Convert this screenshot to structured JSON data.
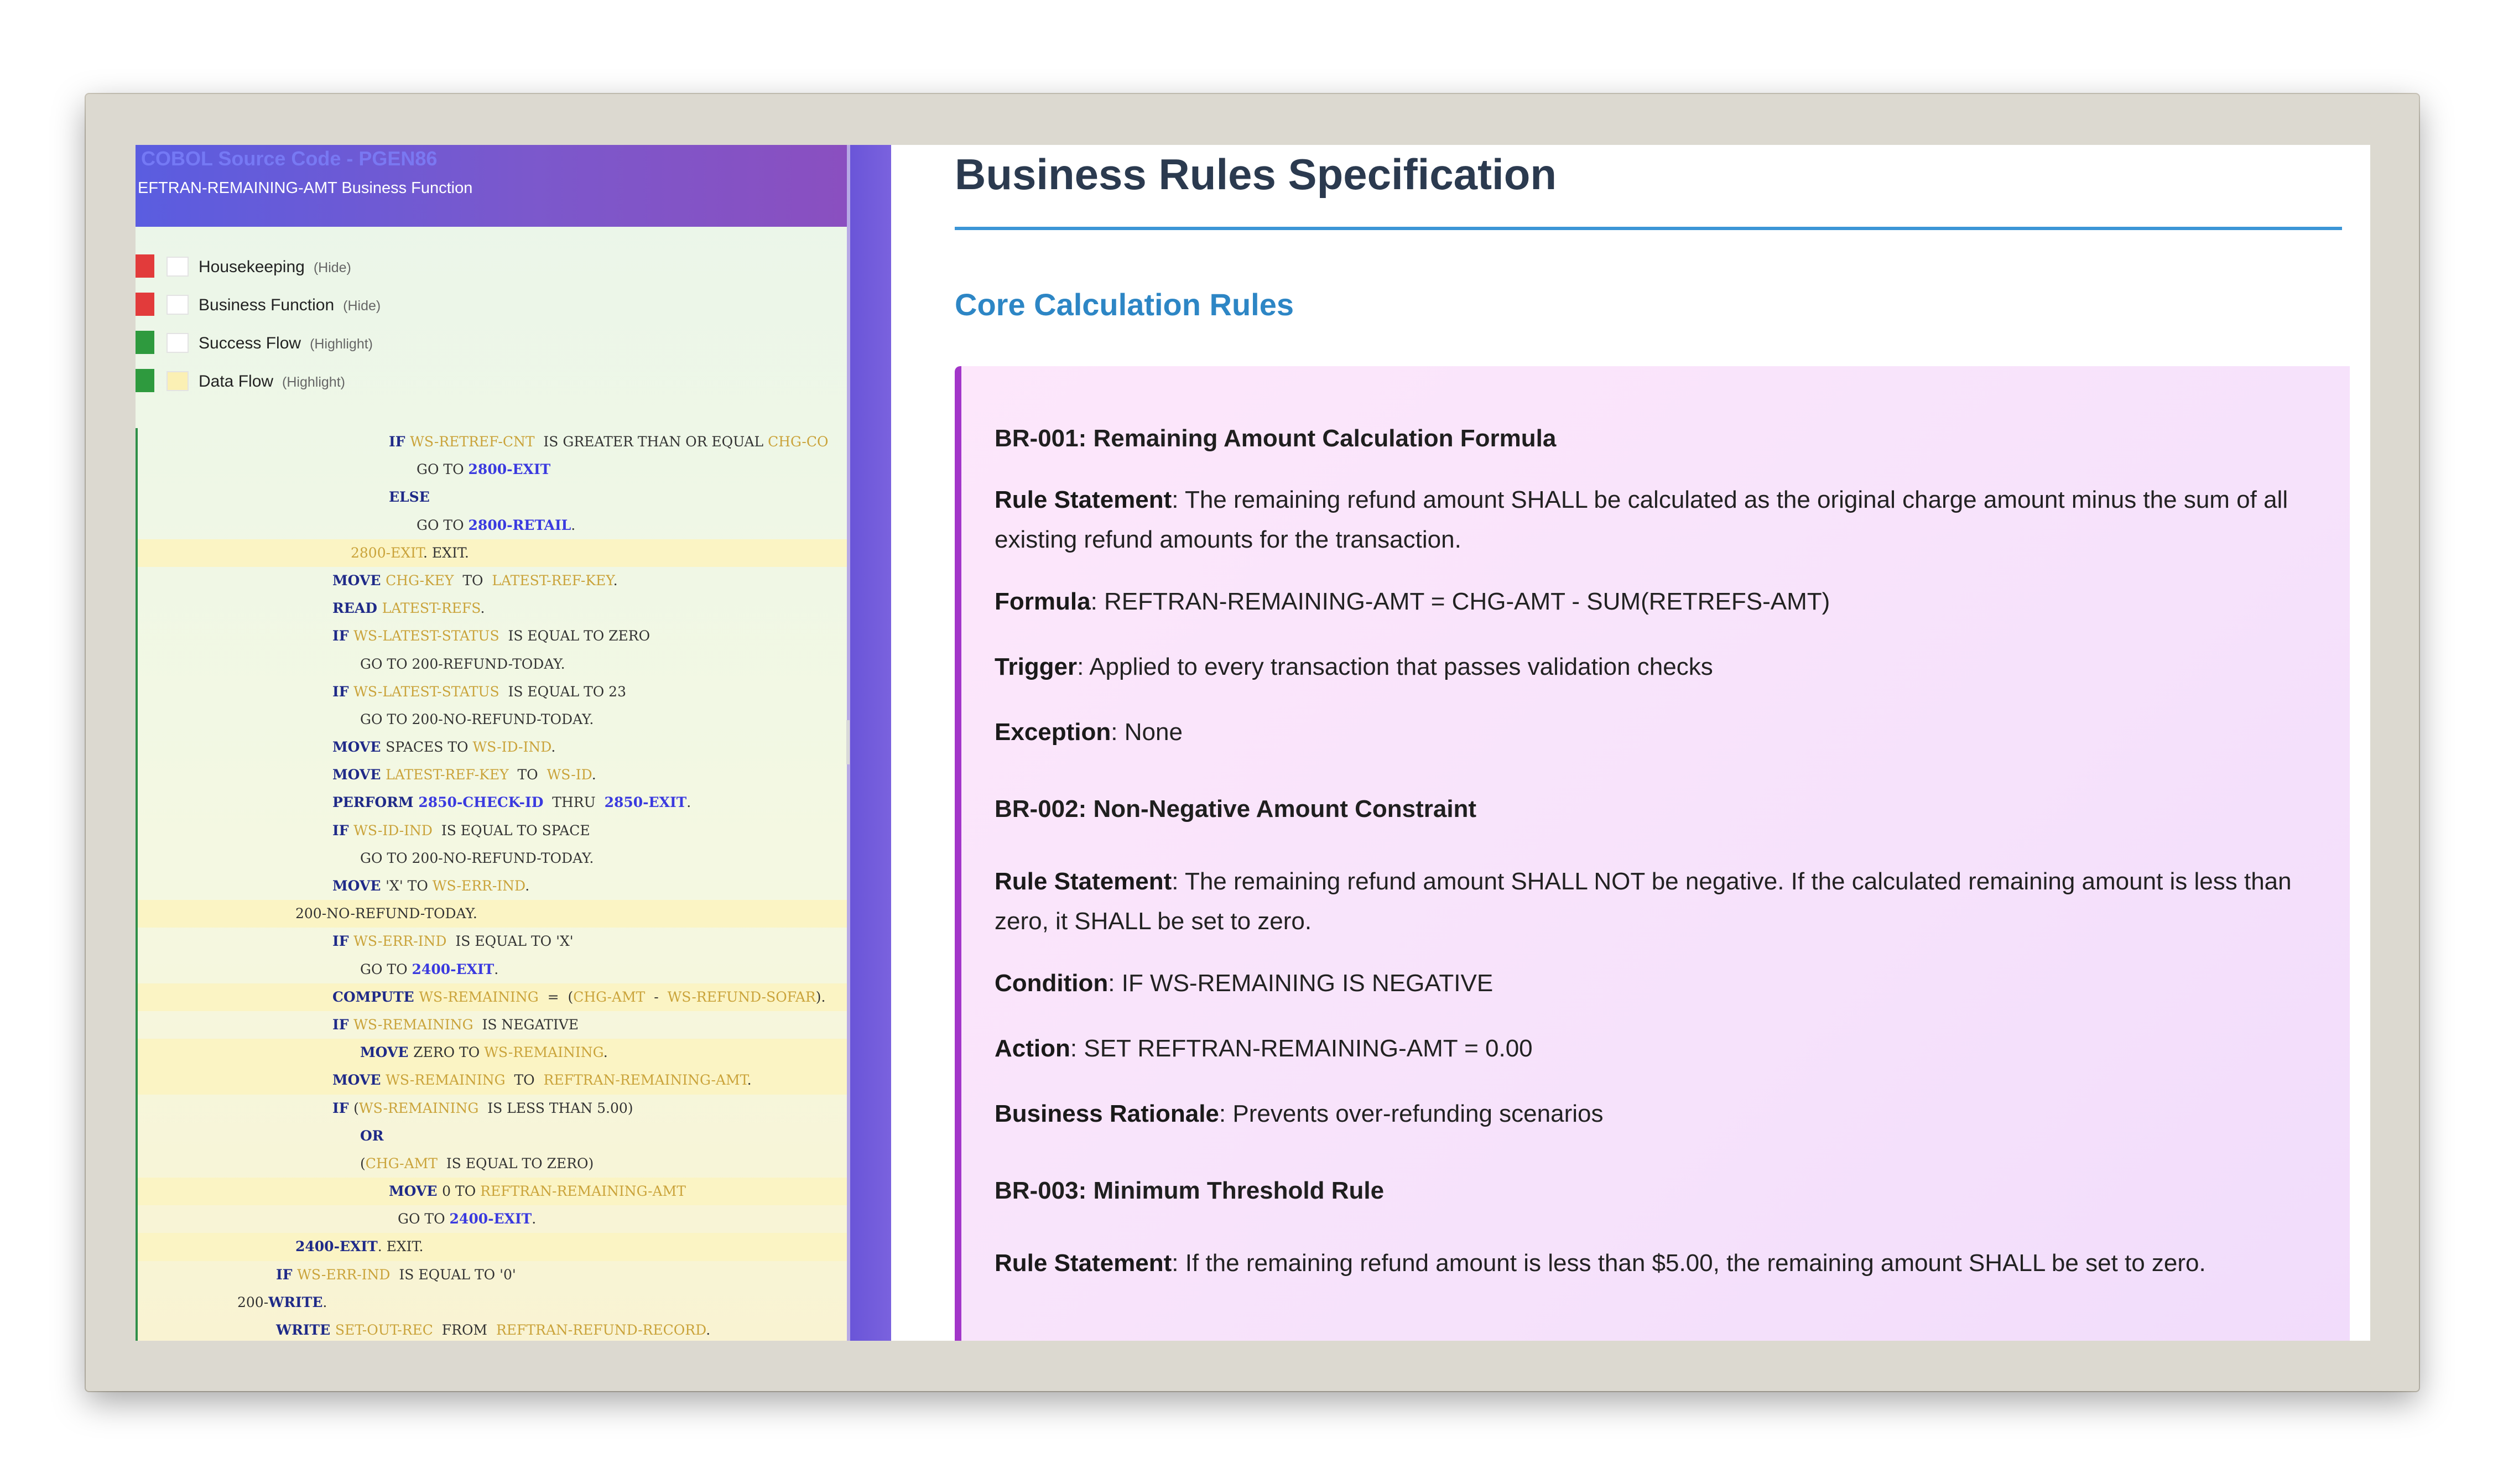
{
  "left_panel": {
    "title": "COBOL Source Code - PGEN86",
    "subtitle": "EFTRAN-REMAINING-AMT Business Function",
    "legend": [
      {
        "label": "Housekeeping",
        "action": "(Hide)",
        "color": "#e23b3b",
        "box": "#ffffff"
      },
      {
        "label": "Business Function",
        "action": "(Hide)",
        "color": "#e23b3b",
        "box": "#ffffff"
      },
      {
        "label": "Success Flow",
        "action": "(Highlight)",
        "color": "#2e9a3e",
        "box": "#ffffff"
      },
      {
        "label": "Data Flow",
        "action": "(Highlight)",
        "color": "#2e9a3e",
        "box": "#fbf0b4"
      }
    ],
    "code_lines": [
      {
        "indent": 454,
        "hl": false,
        "tokens": [
          [
            "kw",
            "IF "
          ],
          [
            "var",
            "WS-RETREF-CNT"
          ],
          [
            "",
            "  IS GREATER THAN OR EQUAL "
          ],
          [
            "var",
            "CHG-CO"
          ]
        ]
      },
      {
        "indent": 504,
        "hl": false,
        "tokens": [
          [
            "",
            "GO TO "
          ],
          [
            "lbl",
            "2800-EXIT"
          ]
        ]
      },
      {
        "indent": 454,
        "hl": false,
        "tokens": [
          [
            "kw",
            "ELSE"
          ]
        ]
      },
      {
        "indent": 504,
        "hl": false,
        "tokens": [
          [
            "",
            "GO TO "
          ],
          [
            "lbl",
            "2800-RETAIL"
          ],
          [
            "",
            "."
          ]
        ]
      },
      {
        "indent": 385,
        "hl": true,
        "tokens": [
          [
            "var",
            "2800-EXIT"
          ],
          [
            "",
            ". EXIT."
          ]
        ]
      },
      {
        "indent": 352,
        "hl": false,
        "tokens": [
          [
            "kw",
            "MOVE "
          ],
          [
            "var",
            "CHG-KEY"
          ],
          [
            "",
            "  TO  "
          ],
          [
            "var",
            "LATEST-REF-KEY"
          ],
          [
            "",
            "."
          ]
        ]
      },
      {
        "indent": 352,
        "hl": false,
        "tokens": [
          [
            "kw",
            "READ "
          ],
          [
            "var",
            "LATEST-REFS"
          ],
          [
            "",
            "."
          ]
        ]
      },
      {
        "indent": 352,
        "hl": false,
        "tokens": [
          [
            "kw",
            "IF "
          ],
          [
            "var",
            "WS-LATEST-STATUS"
          ],
          [
            "",
            "  IS EQUAL TO ZERO"
          ]
        ]
      },
      {
        "indent": 402,
        "hl": false,
        "tokens": [
          [
            "",
            "GO TO 200-REFUND-TODAY."
          ]
        ]
      },
      {
        "indent": 352,
        "hl": false,
        "tokens": [
          [
            "kw",
            "IF "
          ],
          [
            "var",
            "WS-LATEST-STATUS"
          ],
          [
            "",
            "  IS EQUAL TO 23"
          ]
        ]
      },
      {
        "indent": 402,
        "hl": false,
        "tokens": [
          [
            "",
            "GO TO 200-NO-REFUND-TODAY."
          ]
        ]
      },
      {
        "indent": 352,
        "hl": false,
        "tokens": [
          [
            "kw",
            "MOVE "
          ],
          [
            "",
            "SPACES TO "
          ],
          [
            "var",
            "WS-ID-IND"
          ],
          [
            "",
            "."
          ]
        ]
      },
      {
        "indent": 352,
        "hl": false,
        "tokens": [
          [
            "kw",
            "MOVE "
          ],
          [
            "var",
            "LATEST-REF-KEY"
          ],
          [
            "",
            "  TO  "
          ],
          [
            "var",
            "WS-ID"
          ],
          [
            "",
            "."
          ]
        ]
      },
      {
        "indent": 352,
        "hl": false,
        "tokens": [
          [
            "kw",
            "PERFORM "
          ],
          [
            "lbl",
            "2850-CHECK-ID"
          ],
          [
            "",
            "  THRU  "
          ],
          [
            "lbl",
            "2850-EXIT"
          ],
          [
            "",
            "."
          ]
        ]
      },
      {
        "indent": 352,
        "hl": false,
        "tokens": [
          [
            "kw",
            "IF "
          ],
          [
            "var",
            "WS-ID-IND"
          ],
          [
            "",
            "  IS EQUAL TO SPACE"
          ]
        ]
      },
      {
        "indent": 402,
        "hl": false,
        "tokens": [
          [
            "",
            "GO TO 200-NO-REFUND-TODAY."
          ]
        ]
      },
      {
        "indent": 352,
        "hl": false,
        "tokens": [
          [
            "kw",
            "MOVE "
          ],
          [
            "",
            "'X' TO "
          ],
          [
            "var",
            "WS-ERR-IND"
          ],
          [
            "",
            "."
          ]
        ]
      },
      {
        "indent": 285,
        "hl": true,
        "tokens": [
          [
            "",
            "200-NO-REFUND-TODAY."
          ]
        ]
      },
      {
        "indent": 352,
        "hl": false,
        "tokens": [
          [
            "kw",
            "IF "
          ],
          [
            "var",
            "WS-ERR-IND"
          ],
          [
            "",
            "  IS EQUAL TO 'X'"
          ]
        ]
      },
      {
        "indent": 402,
        "hl": false,
        "tokens": [
          [
            "",
            "GO TO "
          ],
          [
            "lbl",
            "2400-EXIT"
          ],
          [
            "",
            "."
          ]
        ]
      },
      {
        "indent": 352,
        "hl": true,
        "tokens": [
          [
            "kw",
            "COMPUTE "
          ],
          [
            "var",
            "WS-REMAINING"
          ],
          [
            "",
            "  =  ("
          ],
          [
            "var",
            "CHG-AMT"
          ],
          [
            "",
            "  -  "
          ],
          [
            "var",
            "WS-REFUND-SOFAR"
          ],
          [
            "",
            ")."
          ]
        ]
      },
      {
        "indent": 352,
        "hl": false,
        "tokens": [
          [
            "kw",
            "IF "
          ],
          [
            "var",
            "WS-REMAINING"
          ],
          [
            "",
            "  IS NEGATIVE"
          ]
        ]
      },
      {
        "indent": 402,
        "hl": true,
        "tokens": [
          [
            "kw",
            "MOVE "
          ],
          [
            "",
            "ZERO TO "
          ],
          [
            "var",
            "WS-REMAINING"
          ],
          [
            "",
            "."
          ]
        ]
      },
      {
        "indent": 352,
        "hl": true,
        "tokens": [
          [
            "kw",
            "MOVE "
          ],
          [
            "var",
            "WS-REMAINING"
          ],
          [
            "",
            "  TO  "
          ],
          [
            "var",
            "REFTRAN-REMAINING-AMT"
          ],
          [
            "",
            "."
          ]
        ]
      },
      {
        "indent": 352,
        "hl": false,
        "tokens": [
          [
            "kw",
            "IF "
          ],
          [
            "",
            "("
          ],
          [
            "var",
            "WS-REMAINING"
          ],
          [
            "",
            "  IS LESS THAN 5.00)"
          ]
        ]
      },
      {
        "indent": 402,
        "hl": false,
        "tokens": [
          [
            "kw",
            "OR"
          ]
        ]
      },
      {
        "indent": 402,
        "hl": false,
        "tokens": [
          [
            "",
            "("
          ],
          [
            "var",
            "CHG-AMT"
          ],
          [
            "",
            "  IS EQUAL TO ZERO)"
          ]
        ]
      },
      {
        "indent": 454,
        "hl": true,
        "tokens": [
          [
            "kw",
            "MOVE "
          ],
          [
            "",
            "0 TO "
          ],
          [
            "var",
            "REFTRAN-REMAINING-AMT"
          ]
        ]
      },
      {
        "indent": 470,
        "hl": false,
        "tokens": [
          [
            "",
            "GO TO "
          ],
          [
            "lbl",
            "2400-EXIT"
          ],
          [
            "",
            "."
          ]
        ]
      },
      {
        "indent": 285,
        "hl": true,
        "tokens": [
          [
            "kw",
            "2400-EXIT"
          ],
          [
            "",
            ". EXIT."
          ]
        ]
      },
      {
        "indent": 250,
        "hl": false,
        "tokens": [
          [
            "kw",
            "IF "
          ],
          [
            "var",
            "WS-ERR-IND"
          ],
          [
            "",
            "  IS EQUAL TO '0'"
          ]
        ]
      },
      {
        "indent": 180,
        "hl": false,
        "tokens": [
          [
            "",
            "200-"
          ],
          [
            "kw",
            "WRITE"
          ],
          [
            "",
            "."
          ]
        ]
      },
      {
        "indent": 250,
        "hl": false,
        "tokens": [
          [
            "kw",
            "WRITE "
          ],
          [
            "var",
            "SET-OUT-REC"
          ],
          [
            "",
            "  FROM  "
          ],
          [
            "var",
            "REFTRAN-REFUND-RECORD"
          ],
          [
            "",
            "."
          ]
        ]
      }
    ]
  },
  "right_panel": {
    "title": "Business Rules Specification",
    "section_title": "Core Calculation Rules",
    "rules": [
      {
        "heading": "BR-001: Remaining Amount Calculation Formula",
        "items": [
          {
            "label": "Rule Statement",
            "text": "The remaining refund amount SHALL be calculated as the original charge amount minus the sum of all existing refund amounts for the transaction."
          },
          {
            "label": "Formula",
            "text": "REFTRAN-REMAINING-AMT = CHG-AMT - SUM(RETREFS-AMT)"
          },
          {
            "label": "Trigger",
            "text": "Applied to every transaction that passes validation checks"
          },
          {
            "label": "Exception",
            "text": "None"
          }
        ]
      },
      {
        "heading": "BR-002: Non-Negative Amount Constraint",
        "items": [
          {
            "label": "Rule Statement",
            "text": "The remaining refund amount SHALL NOT be negative. If the calculated remaining amount is less than zero, it SHALL be set to zero."
          },
          {
            "label": "Condition",
            "text": "IF WS-REMAINING IS NEGATIVE"
          },
          {
            "label": "Action",
            "text": "SET REFTRAN-REMAINING-AMT = 0.00"
          },
          {
            "label": "Business Rationale",
            "text": "Prevents over-refunding scenarios"
          }
        ]
      },
      {
        "heading": "BR-003: Minimum Threshold Rule",
        "items": [
          {
            "label": "Rule Statement",
            "text": "If the remaining refund amount is less than $5.00, the remaining amount SHALL be set to zero."
          }
        ]
      }
    ]
  }
}
